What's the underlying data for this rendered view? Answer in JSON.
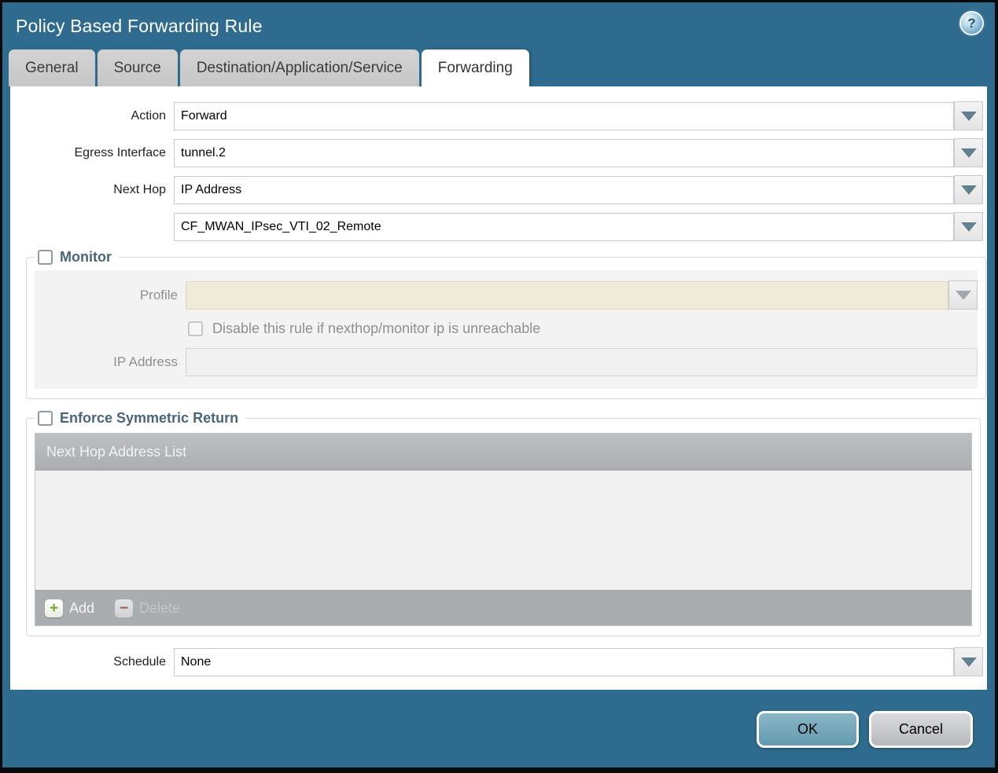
{
  "dialog": {
    "title": "Policy Based Forwarding Rule",
    "help_glyph": "?",
    "tabs": [
      {
        "label": "General"
      },
      {
        "label": "Source"
      },
      {
        "label": "Destination/Application/Service"
      },
      {
        "label": "Forwarding"
      }
    ],
    "active_tab": "Forwarding"
  },
  "form": {
    "action": {
      "label": "Action",
      "value": "Forward"
    },
    "egress_interface": {
      "label": "Egress Interface",
      "value": "tunnel.2"
    },
    "next_hop": {
      "label": "Next Hop",
      "value": "IP Address"
    },
    "next_hop_address": {
      "value": "CF_MWAN_IPsec_VTI_02_Remote"
    },
    "schedule": {
      "label": "Schedule",
      "value": "None"
    }
  },
  "monitor": {
    "legend": "Monitor",
    "checked": false,
    "profile": {
      "label": "Profile",
      "value": ""
    },
    "disable_rule": {
      "label": "Disable this rule if nexthop/monitor ip is unreachable",
      "checked": false
    },
    "ip_address": {
      "label": "IP Address",
      "value": ""
    }
  },
  "symmetric_return": {
    "legend": "Enforce Symmetric Return",
    "checked": false,
    "table": {
      "header": "Next Hop Address List",
      "rows": []
    },
    "add_label": "Add",
    "delete_label": "Delete",
    "add_icon": "+",
    "delete_icon": "−"
  },
  "footer": {
    "ok_label": "OK",
    "cancel_label": "Cancel"
  },
  "colors": {
    "frame_teal": "#2e6b8e",
    "ok_button": "#74a7bb",
    "profile_field": "#f0ebd8",
    "table_header": "#b1b5b8",
    "legend_text": "#4a6578"
  }
}
